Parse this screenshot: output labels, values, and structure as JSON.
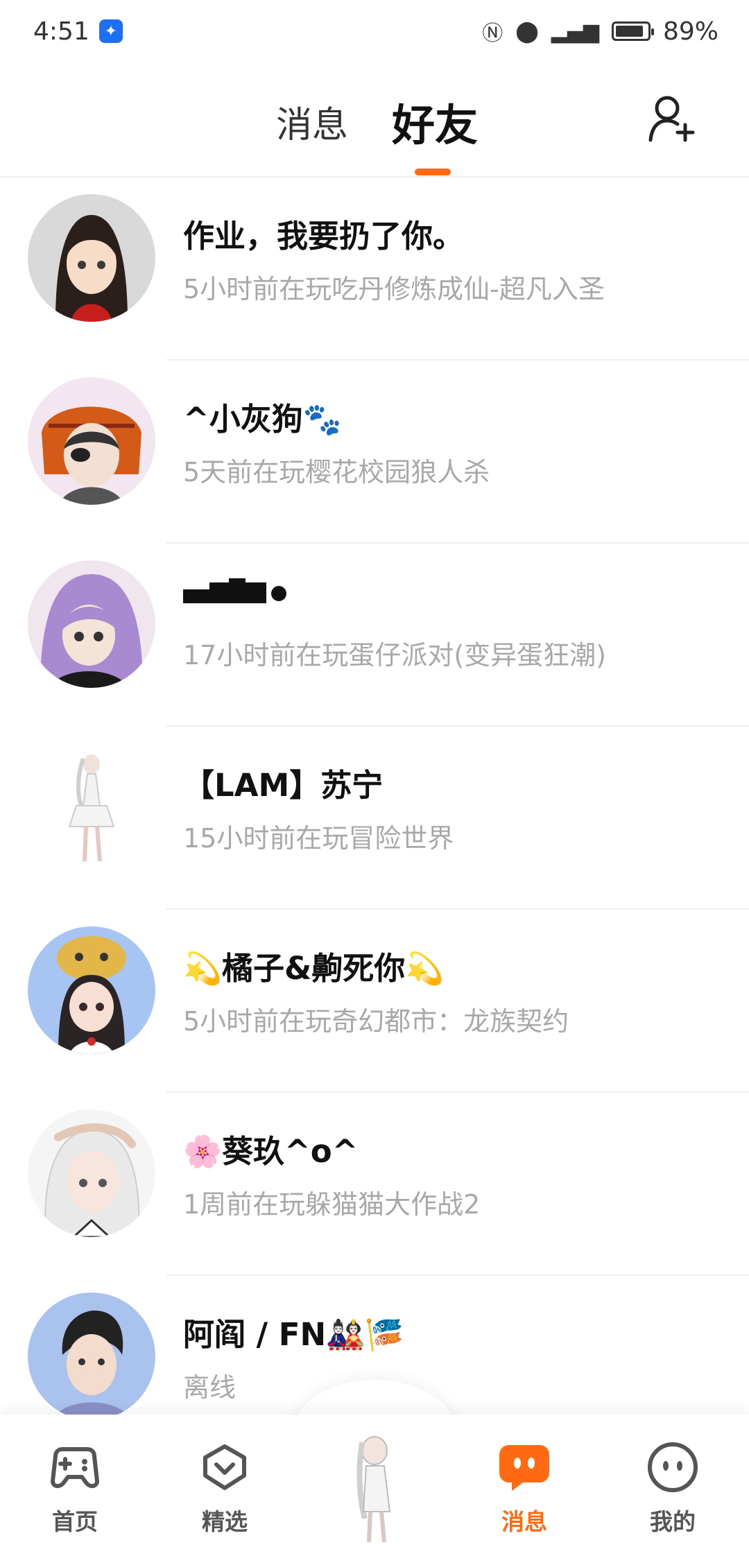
{
  "status_bar": {
    "time": "4:51",
    "battery": "89%",
    "network": "4G"
  },
  "header": {
    "tab_messages": "消息",
    "tab_friends": "好友"
  },
  "friends": [
    {
      "name": "作业，我要扔了你。",
      "status": "5小时前在玩吃丹修炼成仙-超凡入圣"
    },
    {
      "name": "^小灰狗🐾",
      "status": "5天前在玩樱花校园狼人杀"
    },
    {
      "name": "",
      "status": "17小时前在玩蛋仔派对(变异蛋狂潮)"
    },
    {
      "name": "【LAM】苏宁",
      "status": "15小时前在玩冒险世界"
    },
    {
      "name": "💫橘子&齁死你💫",
      "status": "5小时前在玩奇幻都市：龙族契约"
    },
    {
      "name": "🌸葵玖^o^",
      "status": "1周前在玩躲猫猫大作战2"
    },
    {
      "name": "阿阎 / FN🎎🎏",
      "status": "离线"
    }
  ],
  "bottom_nav": {
    "home": "首页",
    "featured": "精选",
    "messages": "消息",
    "mine": "我的"
  },
  "colors": {
    "accent": "#ff6a13",
    "secondary_text": "#a8a8a8"
  }
}
